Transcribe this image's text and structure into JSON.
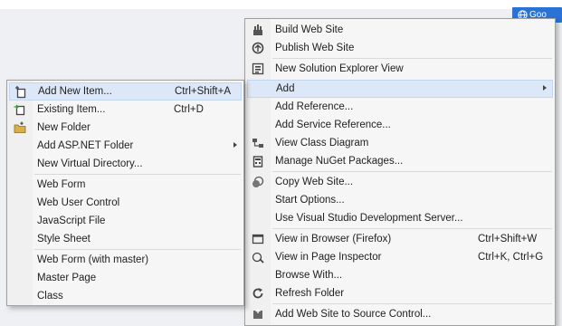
{
  "background": {
    "google_badge": "Goo"
  },
  "main_menu": {
    "items": [
      {
        "label": "Build Web Site",
        "icon": "build-icon"
      },
      {
        "label": "Publish Web Site",
        "icon": "publish-icon"
      },
      {
        "label": "New Solution Explorer View",
        "icon": "solution-explorer-icon"
      },
      {
        "label": "Add",
        "icon": "",
        "highlighted": true
      },
      {
        "label": "Add Reference...",
        "icon": ""
      },
      {
        "label": "Add Service Reference...",
        "icon": ""
      },
      {
        "label": "View Class Diagram",
        "icon": "class-diagram-icon"
      },
      {
        "label": "Manage NuGet Packages...",
        "icon": "nuget-icon"
      },
      {
        "label": "Copy Web Site...",
        "icon": "copy-web-icon"
      },
      {
        "label": "Start Options...",
        "icon": ""
      },
      {
        "label": "Use Visual Studio Development Server...",
        "icon": ""
      },
      {
        "label": "View in Browser (Firefox)",
        "icon": "browser-icon",
        "shortcut": "Ctrl+Shift+W"
      },
      {
        "label": "View in Page Inspector",
        "icon": "page-inspector-icon",
        "shortcut": "Ctrl+K, Ctrl+G"
      },
      {
        "label": "Browse With...",
        "icon": ""
      },
      {
        "label": "Refresh Folder",
        "icon": "refresh-icon"
      },
      {
        "label": "Add Web Site to Source Control...",
        "icon": "source-control-icon"
      }
    ]
  },
  "sub_menu": {
    "items": [
      {
        "label": "Add New Item...",
        "icon": "new-item-icon",
        "shortcut": "Ctrl+Shift+A",
        "highlighted": true
      },
      {
        "label": "Existing Item...",
        "icon": "existing-item-icon",
        "shortcut": "Ctrl+D"
      },
      {
        "label": "New Folder",
        "icon": "new-folder-icon"
      },
      {
        "label": "Add ASP.NET Folder",
        "icon": ""
      },
      {
        "label": "New Virtual Directory...",
        "icon": ""
      },
      {
        "label": "Web Form",
        "icon": ""
      },
      {
        "label": "Web User Control",
        "icon": ""
      },
      {
        "label": "JavaScript File",
        "icon": ""
      },
      {
        "label": "Style Sheet",
        "icon": ""
      },
      {
        "label": "Web Form (with master)",
        "icon": ""
      },
      {
        "label": "Master Page",
        "icon": ""
      },
      {
        "label": "Class",
        "icon": ""
      }
    ]
  }
}
